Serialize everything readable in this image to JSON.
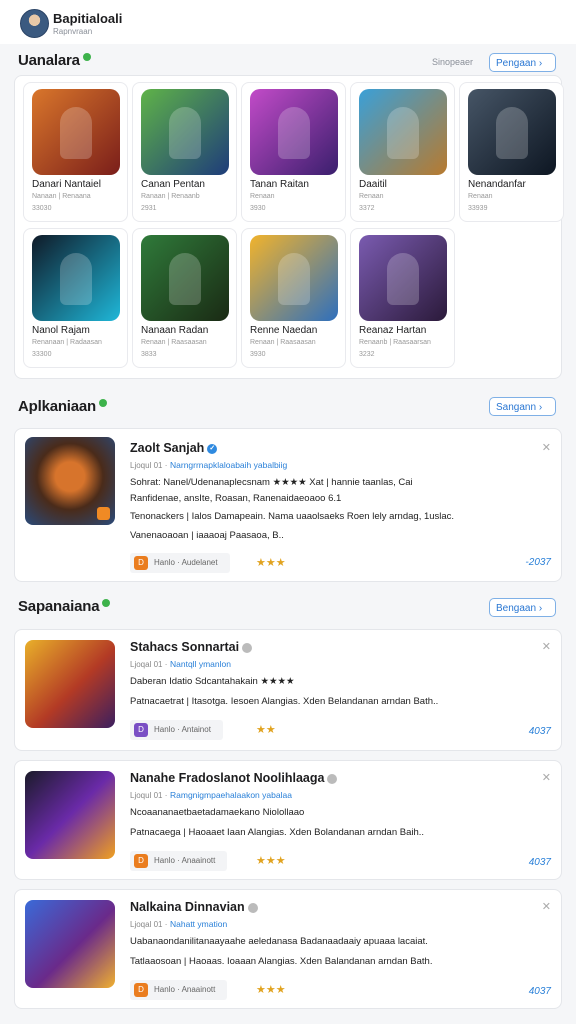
{
  "header": {
    "user_name": "Bapitialoali",
    "user_sub": "Rapnvraan"
  },
  "section1": {
    "title": "Uanalara",
    "see_all": "Sinopeaer",
    "button": "Pengaan",
    "tiles": [
      {
        "title": "Danari Nantaiel",
        "sub": "Nanaan | Renaana",
        "num": "33030",
        "icon": "fighter-game-icon",
        "colors": [
          "#d9762b",
          "#7a1e1a"
        ]
      },
      {
        "title": "Canan Pentan",
        "sub": "Ranaan | Renaanb",
        "num": "2931",
        "icon": "soldiers-game-icon",
        "colors": [
          "#5fb348",
          "#1e3c7a"
        ]
      },
      {
        "title": "Tanan Raitan",
        "sub": "Renaan",
        "num": "3930",
        "icon": "warrior-game-icon",
        "colors": [
          "#c24bc8",
          "#3a1f6d"
        ]
      },
      {
        "title": "Daaitil",
        "sub": "Renaan",
        "num": "3372",
        "icon": "dwarf-game-icon",
        "colors": [
          "#3aa0d8",
          "#b87a2e"
        ]
      },
      {
        "title": "Nenandanfar",
        "sub": "Renaan",
        "num": "33939",
        "icon": "robot-game-icon",
        "colors": [
          "#465566",
          "#0d1622"
        ]
      },
      {
        "title": "Nanol Rajam",
        "sub": "Renanaan | Radaasan",
        "num": "33300",
        "icon": "logo-game-icon",
        "colors": [
          "#0f1a28",
          "#1fb7d8"
        ]
      },
      {
        "title": "Nanaan Radan",
        "sub": "Renaan | Raasaasan",
        "num": "3833",
        "icon": "elf-game-icon",
        "colors": [
          "#2f7a3a",
          "#1a2a14"
        ]
      },
      {
        "title": "Renne Naedan",
        "sub": "Renaan | Raasaasan",
        "num": "3930",
        "icon": "battle-game-icon",
        "colors": [
          "#f1b32c",
          "#2e6fbd"
        ]
      },
      {
        "title": "Reanaz Hartan",
        "sub": "Renaanb | Raasaarsan",
        "num": "3232",
        "icon": "hero-game-icon",
        "colors": [
          "#7a5bb0",
          "#2b1a3a"
        ]
      }
    ]
  },
  "section2": {
    "title": "Aplkaniaan",
    "button": "Sangann",
    "card": {
      "title": "Zaolt Sanjah",
      "meta_label": "Ljoqul 01 ·",
      "meta_link": "Narngrrnapklaloabaih yabalbiig",
      "l2": "Sohrat: Nanel/Udenanaplecsnam ★★★★  Xat | hannie taanlas, Cai",
      "l3": "Ranfidenae, ansIte, Roasan, Ranenaidaeoaoo 6.1",
      "l4": "Tenonackers | Ialos  Damapeain.  Nama uaaolsaeks  Roen lely arndag, 1uslac.",
      "l5": "Vanenaoaoan | iaaaoaj Paasaoa, B..",
      "badge": "Hanlo · Audelanet",
      "stars": "★★★",
      "num": "-2037",
      "image_icon": "monster-game-icon"
    }
  },
  "section3": {
    "title": "Sapanaiana",
    "button": "Bengaan",
    "cards": [
      {
        "title": "Stahacs Sonnartai",
        "meta_label": "Ljoqal 01 ·",
        "meta_link": "Nantqll ymanlon",
        "l2": "Daberan Idatio Sdcantahakain  ★★★★",
        "l3": "Patnacaetrat | Itasotga. Iesoen Alangias.  Xden Belandanan arndan  Bath..",
        "badge": "Hanlo · Antainot",
        "stars": "★★",
        "num": "4037",
        "badge_color": "#7a4fc4",
        "image_icon": "viking-game-icon"
      },
      {
        "title": "Nanahe Fradoslanot Noolihlaaga",
        "meta_label": "Ljoqul 01 ·",
        "meta_link": "Ramgnigmpaehalaakon yabalaa",
        "l2": "Ncoaananaetbaetadamaekano Niolollaao",
        "l3": "Patnacaega | Haoaaet  Iaan Alangias.  Xden Bolandanan  arndan  Baih..",
        "badge": "Hanlo · Anaainott",
        "stars": "★★★",
        "num": "4037",
        "badge_color": "#ea7d1f",
        "image_icon": "heroes-game-icon"
      },
      {
        "title": "Nalkaina Dinnavian",
        "meta_label": "Ljoqal 01 ·",
        "meta_link": "Nahatt ymation",
        "l2": "Uabanaondanilitanaayaahe aeledanasa  Badanaadaaiy apuaaa lacaiat.",
        "l3": "Tatlaaosoan | Haoaas.  Ioaaan Alangias.  Xden Balandanan  arndan  Bath.",
        "badge": "Hanlo · Anaainott",
        "stars": "★★★",
        "num": "4037",
        "badge_color": "#ea7d1f",
        "image_icon": "wizard-game-icon"
      }
    ]
  }
}
